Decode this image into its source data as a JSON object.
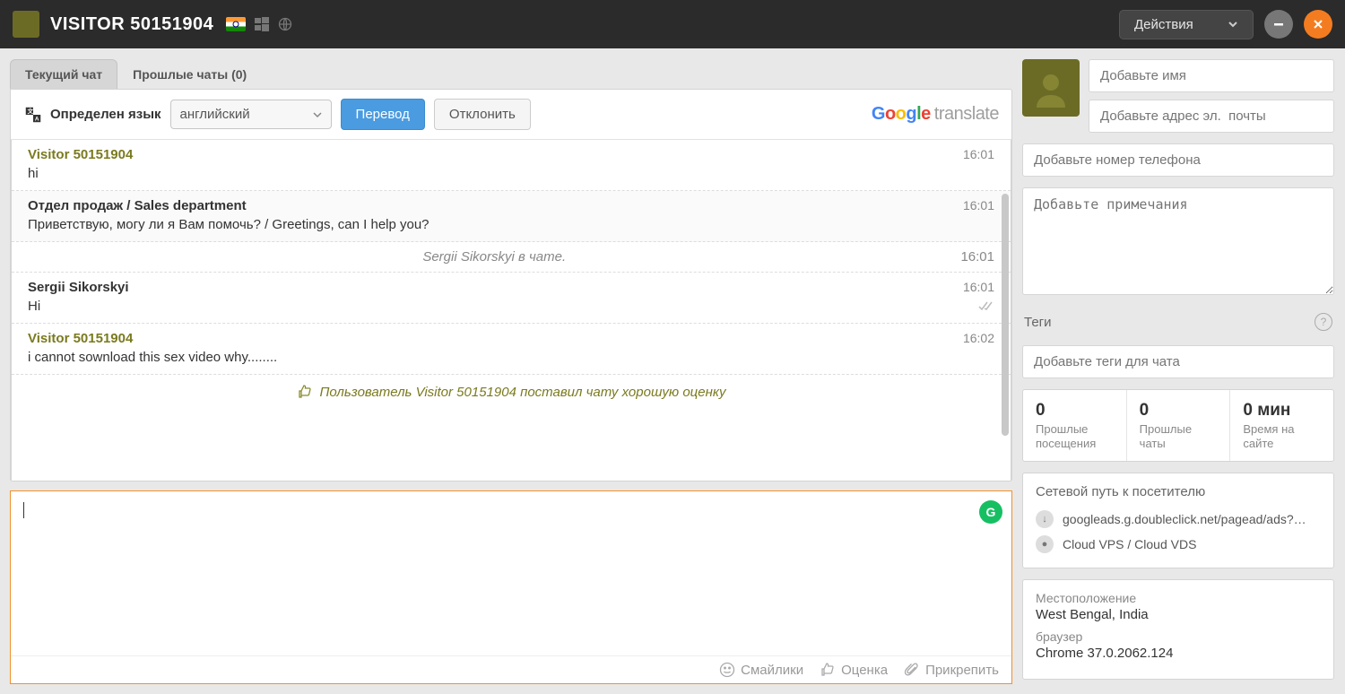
{
  "header": {
    "visitor_title": "VISITOR 50151904",
    "actions_label": "Действия"
  },
  "tabs": {
    "current": "Текущий чат",
    "past": "Прошлые чаты (0)"
  },
  "translate": {
    "detected_label": "Определен язык",
    "language": "английский",
    "translate_btn": "Перевод",
    "dismiss_btn": "Отклонить"
  },
  "messages": [
    {
      "kind": "msg",
      "author": "Visitor 50151904",
      "visitor": true,
      "time": "16:01",
      "body": "hi"
    },
    {
      "kind": "msg",
      "author": "Отдел продаж / Sales department",
      "visitor": false,
      "time": "16:01",
      "body": "Приветствую, могу ли я Вам помочь? / Greetings, can I help you?",
      "alt": true
    },
    {
      "kind": "sys",
      "body": "Sergii Sikorskyi в чате.",
      "time": "16:01"
    },
    {
      "kind": "msg",
      "author": "Sergii Sikorskyi",
      "visitor": false,
      "time": "16:01",
      "body": "Hi",
      "checks": true
    },
    {
      "kind": "msg",
      "author": "Visitor 50151904",
      "visitor": true,
      "time": "16:02",
      "body": "i cannot sownload this sex video why........"
    }
  ],
  "rating_line": "Пользователь Visitor 50151904 поставил чату хорошую оценку",
  "tools": {
    "emoji": "Смайлики",
    "rate": "Оценка",
    "attach": "Прикрепить"
  },
  "side": {
    "name_ph": "Добавьте имя",
    "email_ph": "Добавьте адрес эл.  почты",
    "phone_ph": "Добавьте номер телефона",
    "notes_ph": "Добавьте примечания",
    "tags_label": "Теги",
    "tags_ph": "Добавьте теги для чата",
    "stats": {
      "visits": {
        "val": "0",
        "lbl": "Прошлые посещения"
      },
      "chats": {
        "val": "0",
        "lbl": "Прошлые чаты"
      },
      "time": {
        "val": "0 мин",
        "lbl": "Время на сайте"
      }
    },
    "netpath_title": "Сетевой путь к посетителю",
    "paths": [
      "googleads.g.doubleclick.net/pagead/ads?…",
      "Cloud VPS / Cloud VDS"
    ],
    "location_lbl": "Местоположение",
    "location_val": "West Bengal, India",
    "browser_lbl": "браузер",
    "browser_val": "Chrome 37.0.2062.124"
  }
}
